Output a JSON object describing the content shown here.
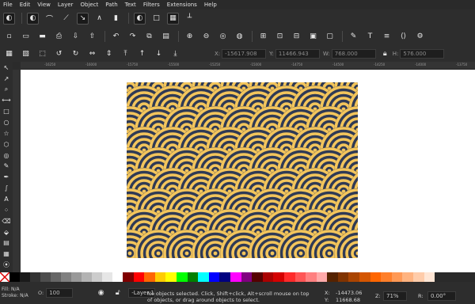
{
  "menu": [
    "File",
    "Edit",
    "View",
    "Layer",
    "Object",
    "Path",
    "Text",
    "Filters",
    "Extensions",
    "Help"
  ],
  "toolbar1_icons": [
    "circle-icon",
    "node-icon",
    "spiro-icon",
    "bspline-icon",
    "bezier-icon",
    "arc-icon",
    "pipe-icon",
    "circle-icon",
    "square-icon",
    "grid-icon",
    "guide-icon"
  ],
  "toolbar2_icons": [
    "new-icon",
    "open-icon",
    "save-icon",
    "print-icon",
    "import-icon",
    "export-icon",
    "undo-icon",
    "redo-icon",
    "copy-icon",
    "paste-icon",
    "zoom-in-icon",
    "zoom-out-icon",
    "zoom-page-icon",
    "zoom-drawing-icon",
    "duplicate-icon",
    "clone-icon",
    "unlink-icon",
    "group-icon",
    "ungroup-icon",
    "fill-stroke-icon",
    "text-icon",
    "align-icon",
    "xml-icon",
    "prefs-icon"
  ],
  "selector_toolbar": {
    "x_label": "X:",
    "x_value": "-15617.908",
    "y_label": "Y:",
    "y_value": "11466.943",
    "w_label": "W:",
    "w_value": "768.000",
    "h_label": "H:",
    "h_value": "576.000"
  },
  "ruler_ticks": [
    "-16250",
    "-16000",
    "-15750",
    "-15500",
    "-15250",
    "-15000",
    "-14750",
    "-14500",
    "-14250",
    "-14000",
    "-13750"
  ],
  "tools": [
    "selector-icon",
    "node-tool-icon",
    "zoom-tool-icon",
    "measure-icon",
    "rect-icon",
    "circle-tool-icon",
    "star-icon",
    "3dbox-icon",
    "spiral-icon",
    "pencil-icon",
    "pen-icon",
    "calligraphy-icon",
    "text-tool-icon",
    "spray-icon",
    "eraser-icon",
    "bucket-icon",
    "gradient-icon",
    "mesh-icon",
    "dropper-icon"
  ],
  "palette": [
    "#000000",
    "#1a1a1a",
    "#333333",
    "#4d4d4d",
    "#666666",
    "#808080",
    "#999999",
    "#b3b3b3",
    "#cccccc",
    "#e6e6e6",
    "#ffffff",
    "#800000",
    "#ff0000",
    "#ff6600",
    "#ffcc00",
    "#ffff00",
    "#00ff00",
    "#008000",
    "#00ffff",
    "#0000ff",
    "#000080",
    "#ff00ff",
    "#800080",
    "#550000",
    "#aa0000",
    "#d40000",
    "#ff2a2a",
    "#ff5555",
    "#ff8080",
    "#ffaaaa",
    "#552200",
    "#803300",
    "#aa4400",
    "#d45500",
    "#ff6600",
    "#ff7f2a",
    "#ff9955",
    "#ffb380",
    "#ffccaa",
    "#ffe6d5"
  ],
  "pattern": {
    "background": "#2f3a55",
    "ring": "#f3c55c"
  },
  "status": {
    "fill_label": "Fill:",
    "fill_value": "N/A",
    "stroke_label": "Stroke:",
    "stroke_value": "N/A",
    "opacity_label": "O:",
    "opacity_value": "100",
    "layer": "-Layer 1",
    "message_line1": "No objects selected. Click, Shift+click, Alt+scroll mouse on top",
    "message_line2": "of objects, or drag around objects to select.",
    "x_label": "X:",
    "x_value": "-14473.06",
    "y_label": "Y:",
    "y_value": "11668.68",
    "zoom_label": "Z:",
    "zoom_value": "71%",
    "rotation_label": "R:",
    "rotation_value": "0.00°"
  }
}
